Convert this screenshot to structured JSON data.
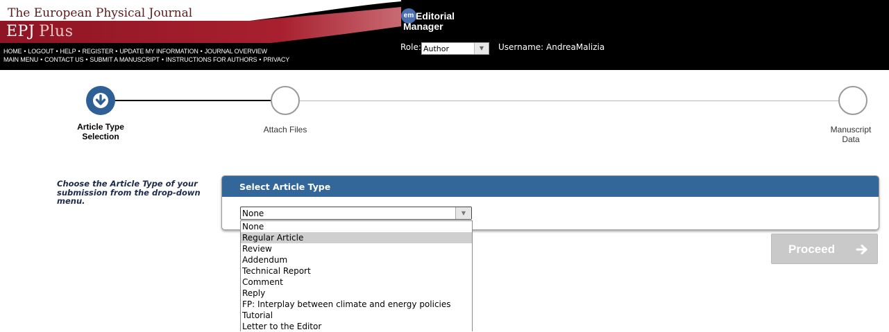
{
  "header": {
    "journal_name": "The European Physical Journal",
    "journal_short": "EPJ",
    "journal_sub": "Plus",
    "nav_row1": [
      "HOME",
      "LOGOUT",
      "HELP",
      "REGISTER",
      "UPDATE MY INFORMATION",
      "JOURNAL OVERVIEW"
    ],
    "nav_row2": [
      "MAIN MENU",
      "CONTACT US",
      "SUBMIT A MANUSCRIPT",
      "INSTRUCTIONS FOR AUTHORS",
      "PRIVACY"
    ],
    "em_badge": "em",
    "em_line1": "Editorial",
    "em_line2": "Manager",
    "role_label": "Role:",
    "role_value": "Author",
    "username_text": "Username: AndreaMalizia"
  },
  "steps": [
    {
      "label_line1": "Article Type",
      "label_line2": "Selection",
      "state": "active"
    },
    {
      "label_line1": "Attach Files",
      "label_line2": "",
      "state": "pending"
    },
    {
      "label_line1": "Manuscript",
      "label_line2": "Data",
      "state": "pending"
    }
  ],
  "main": {
    "instruction": "Choose the Article Type of your submission from the drop-down menu.",
    "panel_title": "Select Article Type",
    "selected_value": "None",
    "options": [
      "None",
      "Regular Article",
      "Review",
      "Addendum",
      "Technical Report",
      "Comment",
      "Reply",
      "FP: Interplay between climate and energy policies",
      "Tutorial",
      "Letter to the Editor"
    ],
    "highlighted_option": "Regular Article",
    "proceed_label": "Proceed"
  },
  "colors": {
    "header_bg": "#000000",
    "logo_red": "#9c1b2a",
    "panel_header": "#346799",
    "step_active": "#2e5f95",
    "proceed_disabled": "#c9c9c9"
  }
}
